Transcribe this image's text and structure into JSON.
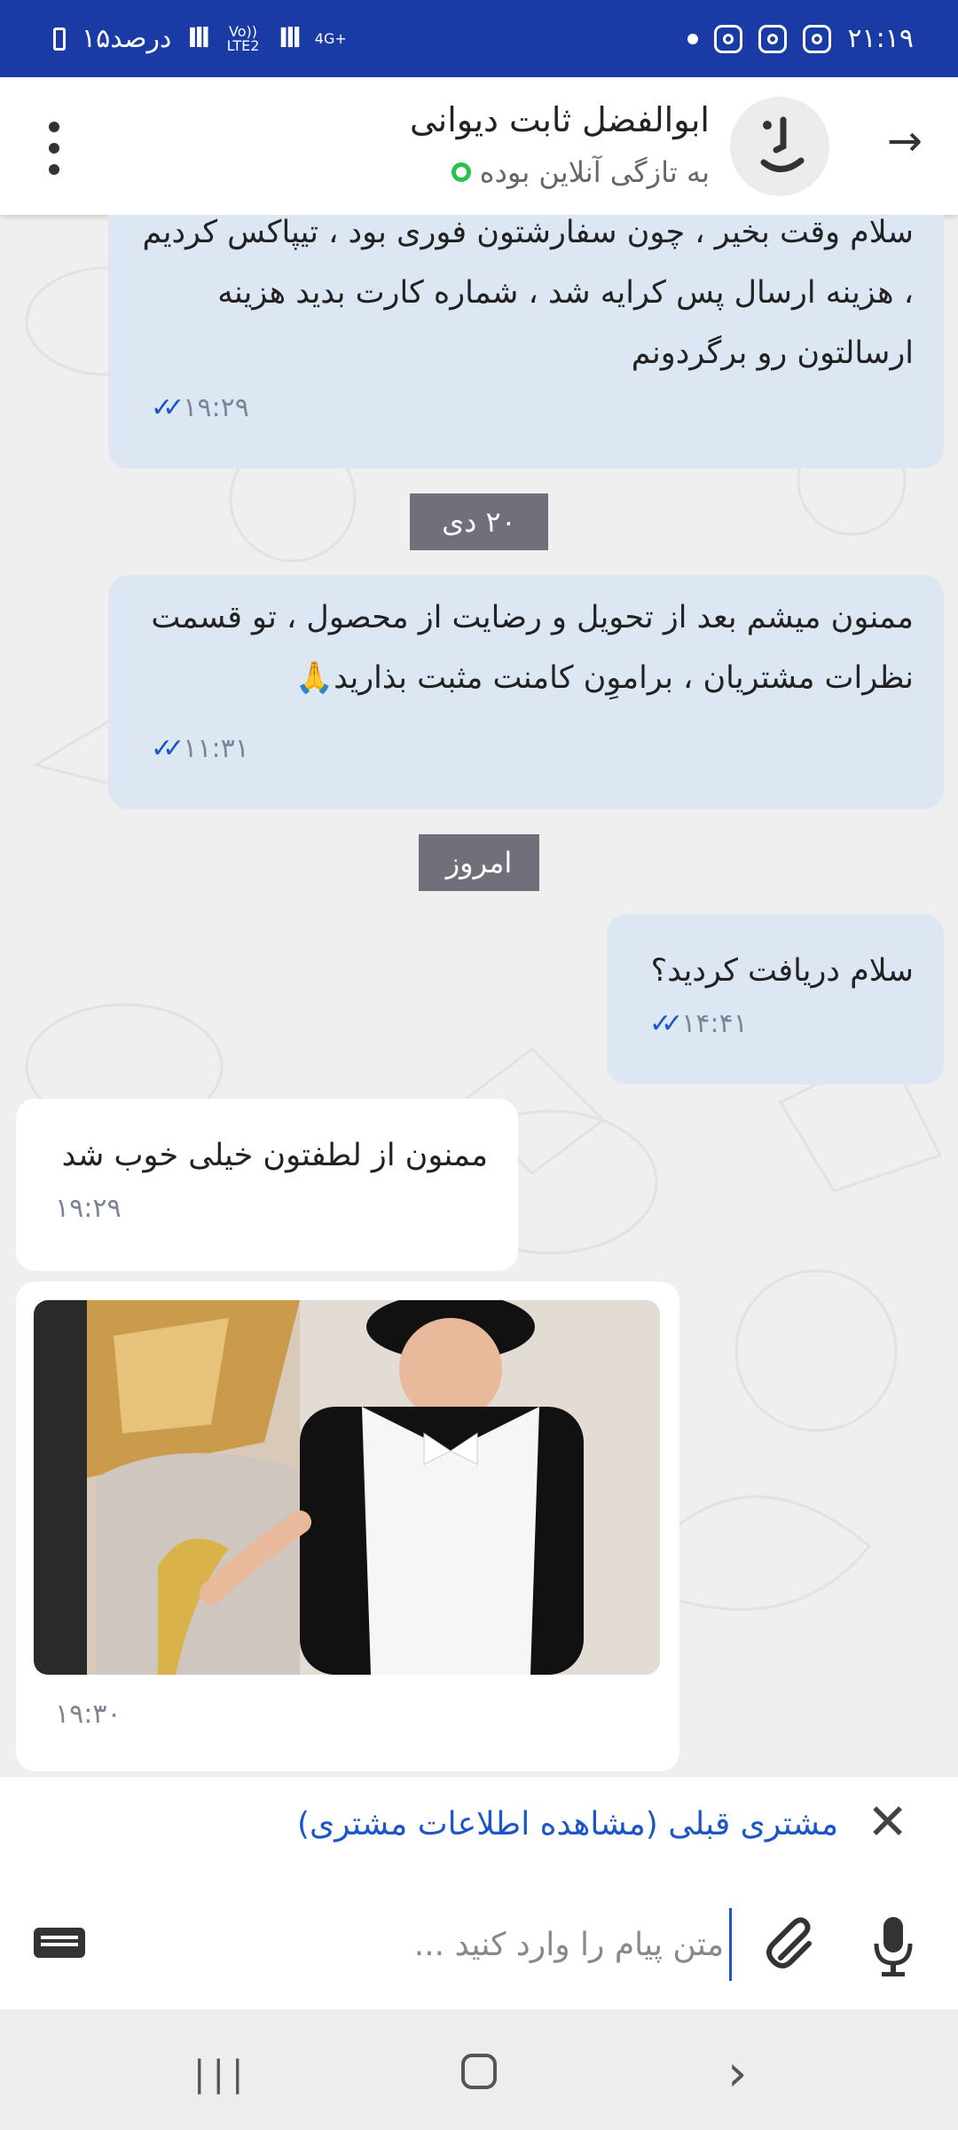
{
  "status_bar": {
    "time": "۲۱:۱۹",
    "battery": "۱۵درصد",
    "network_1": "Vo)) LTE2",
    "network_2": "4G+"
  },
  "header": {
    "contact_name": "ابوالفضل ثابت دیوانی",
    "contact_status": "به تازگی آنلاین بوده"
  },
  "messages": [
    {
      "dir": "out",
      "text": "سلام وقت بخیر ، چون سفارشتون فوری بود ، تیپاکس کردیم ، هزینه ارسال پس کرایه شد ، شماره کارت بدید هزینه ارسالتون رو برگردونم",
      "time": "۱۹:۲۹"
    },
    {
      "dir": "out",
      "text": "ممنون میشم بعد از تحویل و رضایت از محصول ، تو قسمت نظرات مشتریان ، براموِن کامنت مثبت بذارید🙏",
      "time": "۱۱:۳۱"
    },
    {
      "dir": "out",
      "text": "سلام دریافت کردید؟",
      "time": "۱۴:۴۱"
    },
    {
      "dir": "in",
      "text": "ممنون از لطفتون خیلی خوب شد",
      "time": "۱۹:۲۹"
    },
    {
      "dir": "in",
      "text": "",
      "time": "۱۹:۳۰"
    }
  ],
  "date_separators": [
    "۲۰ دی",
    "امروز"
  ],
  "customer_bar": {
    "link_text": "مشتری قبلی (مشاهده اطلاعات مشتری)"
  },
  "composer": {
    "placeholder": "متن پیام را وارد کنید ..."
  },
  "colors": {
    "status_bar": "#1a3aa6",
    "outgoing_bubble": "#dde7f3",
    "incoming_bubble": "#ffffff",
    "accent": "#1a56c8",
    "online": "#27c24c"
  }
}
